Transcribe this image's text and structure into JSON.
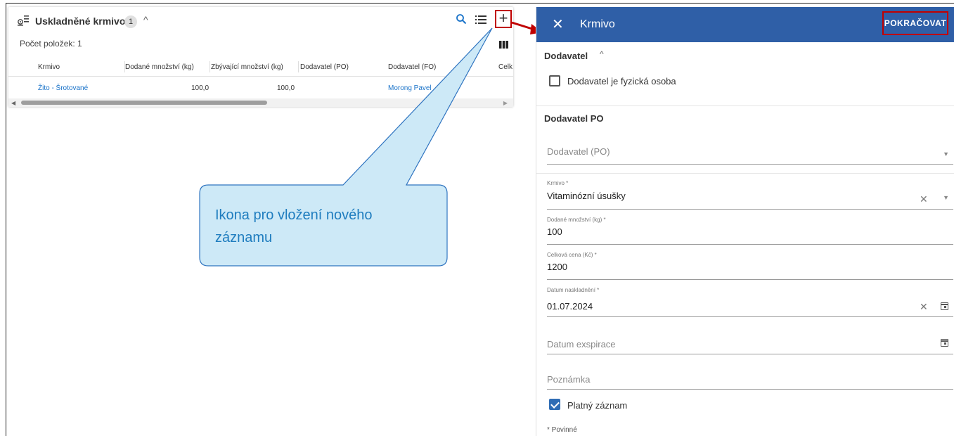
{
  "left_card": {
    "title": "Uskladněné krmivo",
    "badge": "1",
    "count_label": "Počet položek: 1",
    "columns": [
      "Krmivo",
      "Dodané množství (kg)",
      "Zbývající množství (kg)",
      "Dodavatel (PO)",
      "Dodavatel (FO)",
      "Celk"
    ],
    "rows": [
      {
        "krmivo": "Žito - Šrotované",
        "dodane": "100,0",
        "zbyvajici": "100,0",
        "dodavatel_po": "",
        "dodavatel_fo": "Morong Pavel"
      }
    ],
    "icons": {
      "list": "list-icon",
      "search": "search-icon",
      "add": "plus-icon",
      "columns": "columns-icon",
      "collapse": "chevron-up-icon"
    }
  },
  "callout": {
    "text": "Ikona pro vložení nového záznamu",
    "fill": "#cde9f7",
    "stroke": "#2f74c0",
    "arrow_color": "#c00000"
  },
  "panel": {
    "title": "Krmivo",
    "continue_label": "POKRAČOVAT",
    "bar_color": "#2f5fa7",
    "section_supplier": "Dodavatel",
    "checkbox_physical": "Dodavatel je fyzická osoba",
    "section_po": "Dodavatel PO",
    "field_supplier_po": {
      "placeholder": "Dodavatel (PO)"
    },
    "field_krmivo": {
      "label": "Krmivo *",
      "value": "Vitaminózní úsušky"
    },
    "field_dodane": {
      "label": "Dodané množství (kg) *",
      "value": "100"
    },
    "field_cena": {
      "label": "Celková cena (Kč) *",
      "value": "1200"
    },
    "field_datum_nask": {
      "label": "Datum naskladnění *",
      "value": "01.07.2024"
    },
    "field_expirace": {
      "placeholder": "Datum exspirace"
    },
    "field_poznamka": {
      "placeholder": "Poznámka"
    },
    "checkbox_valid": "Platný záznam",
    "required_note": "* Povinné"
  }
}
